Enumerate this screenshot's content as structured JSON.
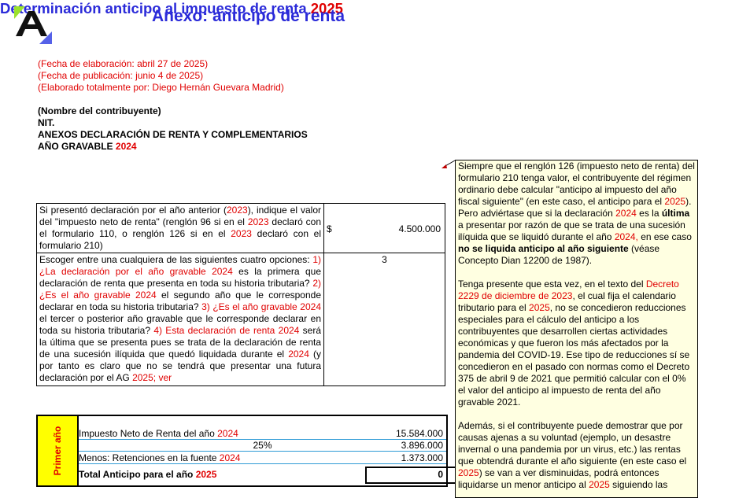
{
  "title": "Anexo: anticipo de renta",
  "meta": {
    "fecha_elaboracion": "(Fecha de elaboración: abril 27 de 2025)",
    "fecha_publicacion": "(Fecha de publicación: junio 4 de 2025)",
    "elaborado": "(Elaborado totalmente por: Diego Hernán Guevara Madrid)"
  },
  "header": {
    "nombre": "(Nombre del contribuyente)",
    "nit": "NIT.",
    "anexos": "ANEXOS DECLARACIÓN DE RENTA Y COMPLEMENTARIOS",
    "ano_label": "AÑO GRAVABLE ",
    "ano_value": "2024"
  },
  "subtitle": {
    "text": "Determinación anticipo al impuesto de renta ",
    "year": "2025"
  },
  "question1": {
    "p1": "Si presentó declaración por el año anterior (",
    "y1": "2023",
    "p2": "), indique el valor del \"impuesto neto de renta\" (renglón 96 si en el ",
    "y2": "2023",
    "p3": " declaró con el formulario 110, o renglón 126 si en el ",
    "y3": "2023",
    "p4": " declaró con el formulario 210)",
    "currency": "$",
    "amount": "4.500.000"
  },
  "question2": {
    "intro": "Escoger entre una cualquiera de las siguientes cuatro opciones: ",
    "o1a": "1) ¿La declaración por el año gravable ",
    "y1": "2024",
    "o1b": " es la primera que declaración de renta que presenta en toda su historia tributaria? ",
    "o2a": "2) ¿Es el año gravable ",
    "y2": "2024",
    "o2b": " el segundo año que le corresponde declarar en toda su historia tributaria? ",
    "o3a": "3) ¿Es el año gravable ",
    "y3": "2024",
    "o3b": " el tercer o posterior año gravable que le corresponde declarar en toda su historia tributaria? ",
    "o4a": "4) Esta declaración de renta ",
    "y4": "2024",
    "o4b": " será la última que se presenta pues se trata de la declaración de renta de una sucesión ilíquida que quedó liquidada durante el ",
    "y5": "2024",
    "o4c": " (y por tanto es claro que no se tendrá que presentar una futura declaración por el AG ",
    "y6": "2025",
    "o4d": "; ver",
    "selected": "3"
  },
  "summary": {
    "side_label": "Primer año",
    "r1_label": "Impuesto Neto de Renta del año ",
    "r1_year": "2024",
    "r1_value": "15.584.000",
    "r2_label": "25%",
    "r2_value": "3.896.000",
    "r3_label": "Menos: Retenciones en la fuente ",
    "r3_year": "2024",
    "r3_value": "1.373.000",
    "r4_label": "Total Anticipo para el año ",
    "r4_year": "2025",
    "r4_value": "0"
  },
  "comment": {
    "a1": "Siempre que el renglón 126 (impuesto neto de renta) del formulario 210 tenga valor, el contribuyente del régimen ordinario debe calcular \"anticipo al impuesto del año fiscal siguiente\" (en este caso, el anticipo para el ",
    "y1": "2025",
    "a2": "). Pero adviértase que si la declaración ",
    "y2": "2024",
    "a3": " es la ",
    "b1": "última",
    "a4": " a presentar por razón de que se trata de una sucesión ilíquida que se liquidó durante el año ",
    "y3": "2024,",
    "a5": " en ese caso ",
    "b2": "no se liquida anticipo al año siguiente",
    "a6": " (véase Concepto Dian 12200 de 1987).",
    "c1": "Tenga presente que esta vez, en el texto del ",
    "cy1": "Decreto 2229 de diciembre de 2023",
    "c2": ", el cual fija el calendario tributario para el ",
    "cy2": "2025",
    "c3": ", no se concedieron reducciones especiales para el cálculo del anticipo a los contribuyentes que desarrollen ciertas actividades económicas y que fueron los más afectados por la pandemia del COVID-19. Ese tipo de reducciones sí se concedieron en el pasado con normas como el Decreto 375 de abril 9 de 2021 que permitió calcular con el 0% el valor del anticipo al impuesto de renta del año gravable 2021.",
    "d1": "Además, si el contribuyente puede demostrar que por causas ajenas a su voluntad (ejemplo, un desastre invernal o una pandemia por un virus, etc.) las rentas que obtendrá durante el año siguiente (en este caso el ",
    "dy1": "2025",
    "d2": ") se van a ver disminuidas, podrá entonces liquidarse un menor anticipo al ",
    "dy2": "2025",
    "d3": " siguiendo las"
  },
  "colors": {
    "title_blue": "#2b2bd9",
    "accent_red": "#e00000",
    "side_yellow": "#ffff00",
    "comment_bg": "#ffffe1",
    "logo_green": "#9be22d",
    "logo_blue": "#5561e8"
  }
}
